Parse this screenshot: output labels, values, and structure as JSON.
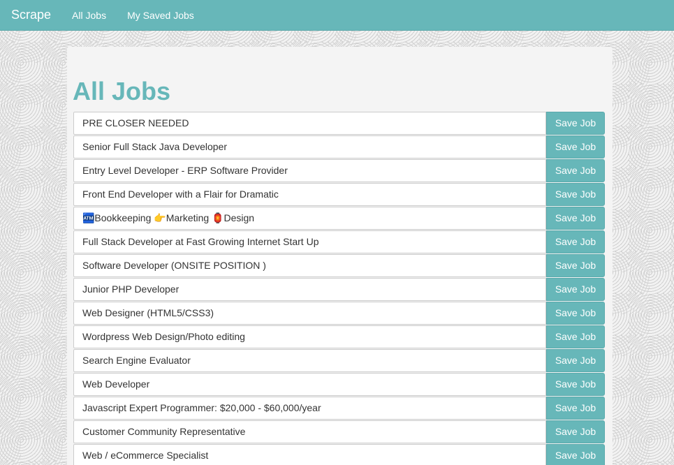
{
  "navbar": {
    "brand": "Scrape",
    "links": [
      "All Jobs",
      "My Saved Jobs"
    ]
  },
  "main": {
    "title": "All Jobs",
    "save_label": "Save Job",
    "jobs": [
      "PRE CLOSER NEEDED",
      "Senior Full Stack Java Developer",
      "Entry Level Developer - ERP Software Provider",
      "Front End Developer with a Flair for Dramatic",
      "🏧Bookkeeping 👉Marketing 🏮Design",
      "Full Stack Developer at Fast Growing Internet Start Up",
      "Software Developer (ONSITE POSITION )",
      "Junior PHP Developer",
      "Web Designer (HTML5/CSS3)",
      "Wordpress Web Design/Photo editing",
      "Search Engine Evaluator",
      "Web Developer",
      "Javascript Expert Programmer: $20,000 - $60,000/year",
      "Customer Community Representative",
      "Web / eCommerce Specialist"
    ]
  },
  "colors": {
    "accent": "#67b7b9"
  }
}
